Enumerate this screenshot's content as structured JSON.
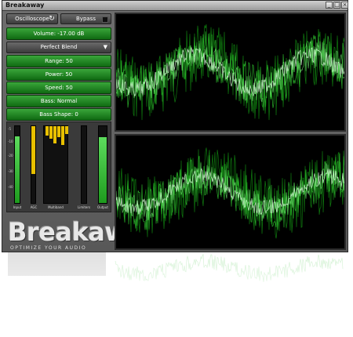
{
  "window": {
    "title": "Breakaway",
    "buttons": [
      "_",
      "□",
      "×"
    ]
  },
  "controls": {
    "mode_label": "Oscilloscope",
    "refresh_icon": "refresh-icon",
    "bypass_label": "Bypass",
    "volume_label": "Volume: -17.00 dB",
    "preset_label": "Perfect Blend",
    "range_label": "Range: 50",
    "power_label": "Power: 50",
    "speed_label": "Speed: 50",
    "bass_label": "Bass: Normal",
    "bass_shape_label": "Bass Shape: 0"
  },
  "meters": {
    "input_label": "Input",
    "agc_label": "AGC",
    "multiband_label": "Multiband",
    "limiters_label": "Limiters",
    "output_label": "Output",
    "input_level": 0.87,
    "agc_level": 0.62,
    "output_level": 0.86
  },
  "logo": {
    "word": "Breakaway",
    "tagline": "OPTIMIZE YOUR AUDIO"
  },
  "colors": {
    "accent_green": "#2fbf2f",
    "meter_yellow": "#e8c000",
    "scope_bg": "#000000"
  }
}
